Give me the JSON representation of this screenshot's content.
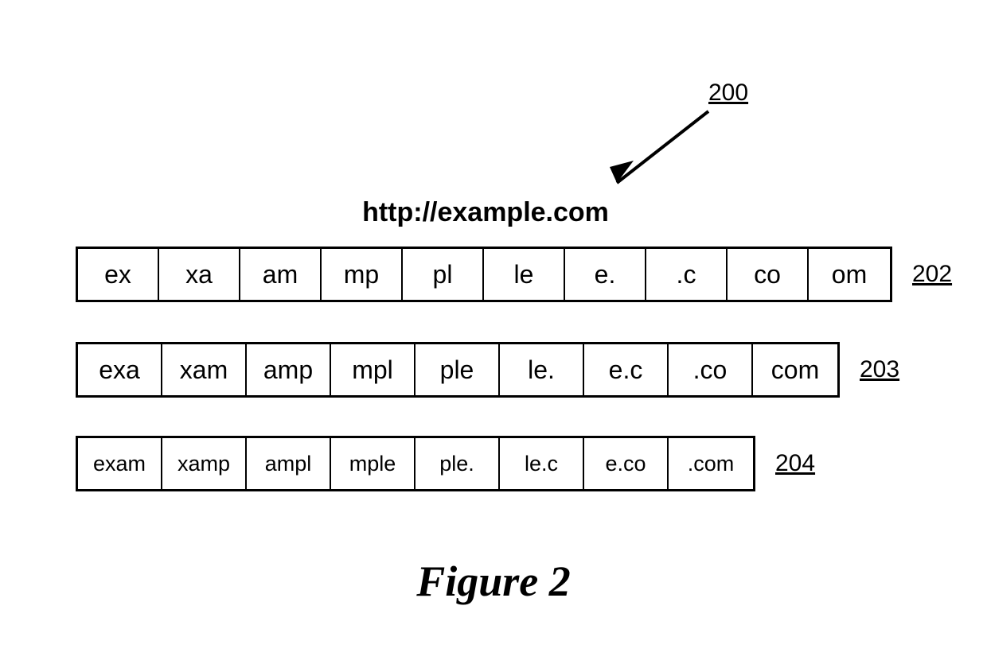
{
  "figure": {
    "main_ref": "200",
    "url": "http://example.com",
    "rows": [
      {
        "ref": "202",
        "cells": [
          "ex",
          "xa",
          "am",
          "mp",
          "pl",
          "le",
          "e.",
          ".c",
          "co",
          "om"
        ]
      },
      {
        "ref": "203",
        "cells": [
          "exa",
          "xam",
          "amp",
          "mpl",
          "ple",
          "le.",
          "e.c",
          ".co",
          "com"
        ]
      },
      {
        "ref": "204",
        "cells": [
          "exam",
          "xamp",
          "ampl",
          "mple",
          "ple.",
          "le.c",
          "e.co",
          ".com"
        ]
      }
    ],
    "caption": "Figure 2"
  }
}
